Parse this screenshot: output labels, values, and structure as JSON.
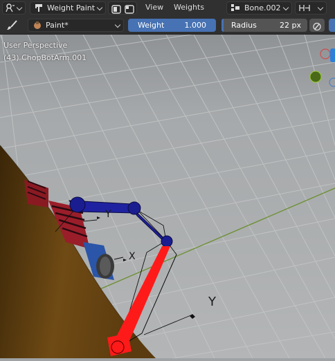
{
  "header": {
    "mode_label": "Weight Paint",
    "menu_view": "View",
    "menu_weights": "Weights",
    "bone_label": "Bone.002"
  },
  "tool_settings": {
    "brush_name": "Paint*",
    "weight_label": "Weight",
    "weight_value": "1.000",
    "radius_label": "Radius",
    "radius_value": "22 px"
  },
  "viewport": {
    "perspective_label": "User Perspective",
    "object_label": "(43) ChopBotArm.001",
    "axis_labels": [
      "Y",
      "X",
      "Y"
    ]
  },
  "colors": {
    "header_bg": "#303030",
    "accent_blue": "#4772b3",
    "bone_selected": "#ff1a1a",
    "bone_weighted": "#1a1a9e",
    "ground_grid": "#a3a6a8"
  }
}
